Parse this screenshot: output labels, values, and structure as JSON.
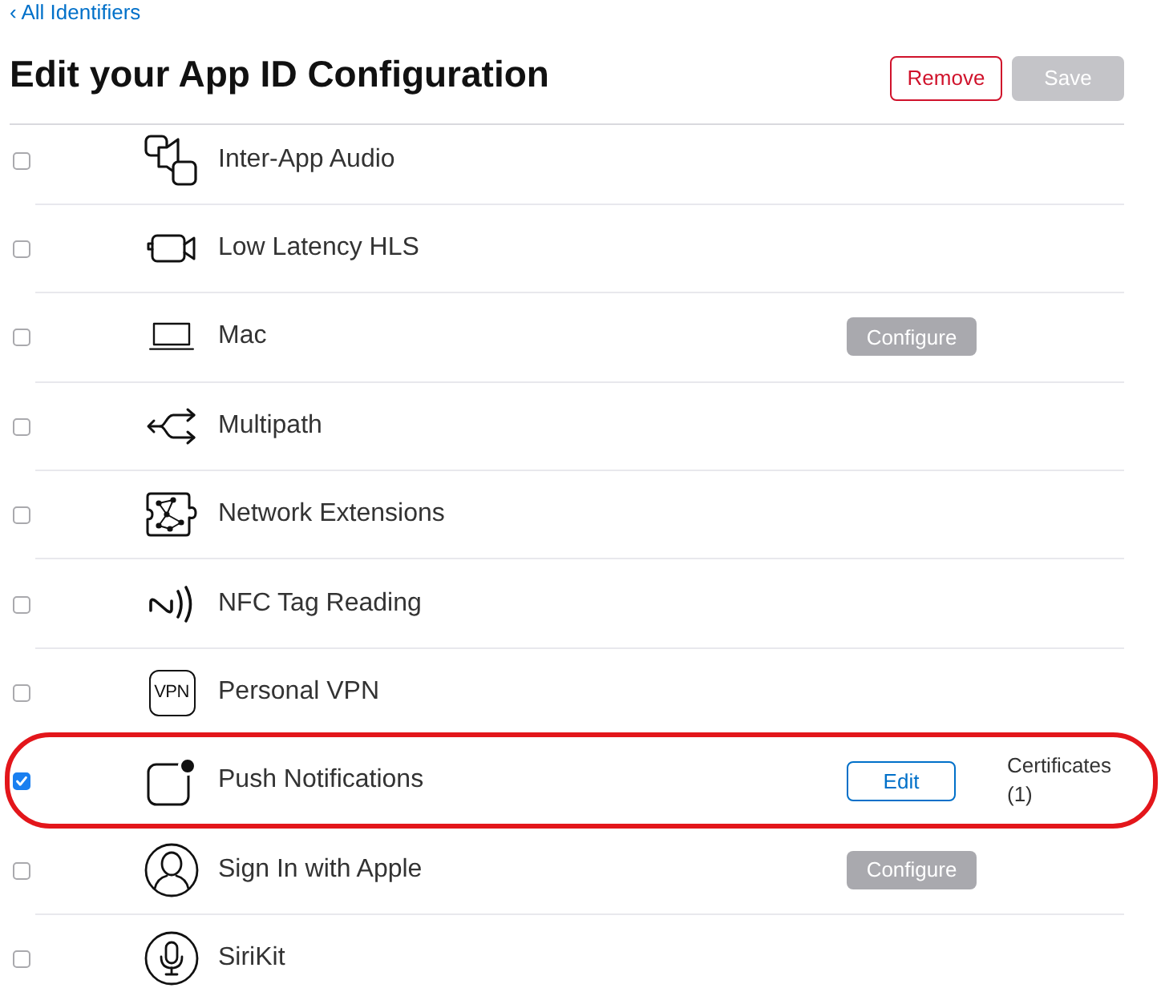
{
  "back_link": {
    "label": "‹ All Identifiers"
  },
  "header": {
    "title": "Edit your App ID Configuration",
    "buttons": [
      {
        "label": "Remove",
        "kind": "destructive",
        "disabled": false
      },
      {
        "label": "Save",
        "kind": "primary",
        "disabled": true
      }
    ]
  },
  "capabilities": [
    {
      "name": "Inter-App Audio",
      "checked": false,
      "highlighted": false
    },
    {
      "name": "Low Latency HLS",
      "checked": false,
      "highlighted": false
    },
    {
      "name": "Mac",
      "checked": false,
      "highlighted": false,
      "action": {
        "label": "Configure",
        "disabled": true
      }
    },
    {
      "name": "Multipath",
      "checked": false,
      "highlighted": false
    },
    {
      "name": "Network Extensions",
      "checked": false,
      "highlighted": false
    },
    {
      "name": "NFC Tag Reading",
      "checked": false,
      "highlighted": false
    },
    {
      "name": "Personal VPN",
      "icon_text": "VPN",
      "checked": false,
      "highlighted": false
    },
    {
      "name": "Push Notifications",
      "checked": true,
      "highlighted": true,
      "action": {
        "label": "Edit",
        "disabled": false
      },
      "note": "Certificates (1)"
    },
    {
      "name": "Sign In with Apple",
      "checked": false,
      "highlighted": false,
      "action": {
        "label": "Configure",
        "disabled": true
      }
    },
    {
      "name": "SiriKit",
      "checked": false,
      "highlighted": false
    }
  ]
}
